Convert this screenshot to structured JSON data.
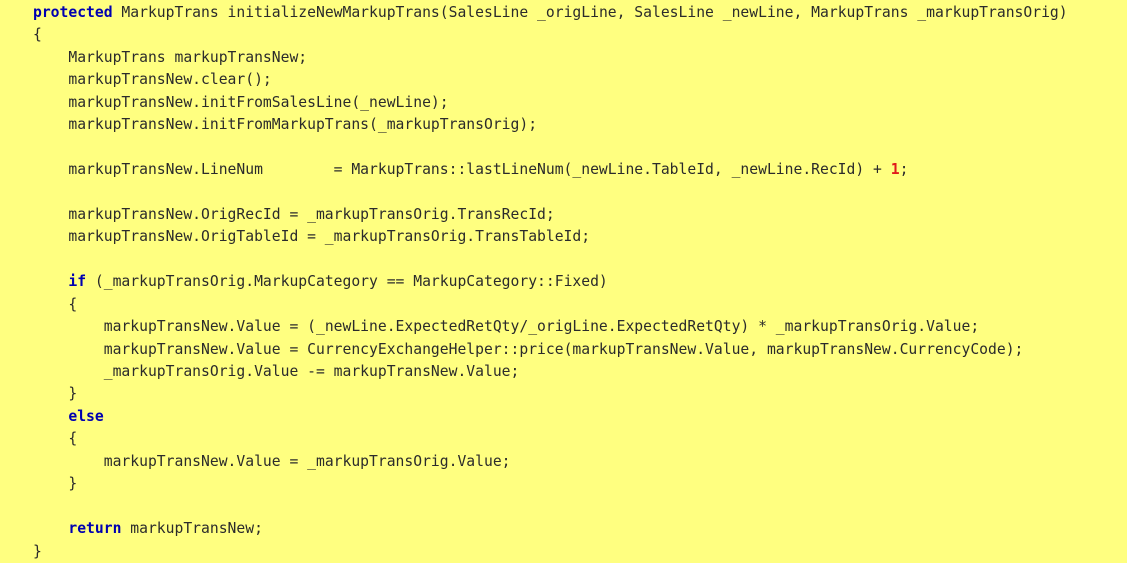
{
  "editor": {
    "name": "code-snippet-viewer",
    "language": "X++",
    "background_color": "#ffff80",
    "text_color": "#2b2b2b",
    "keyword_color": "#0000b0",
    "number_color": "#e01b1b",
    "indent_unit": "    ",
    "font_size_px": 14.7,
    "line_height_px": 22.45
  },
  "code": {
    "line_count": 24,
    "lines": [
      {
        "index": 1,
        "indent": 0,
        "tokens": [
          {
            "t": "kw",
            "v": "protected"
          },
          {
            "t": "pl",
            "v": " MarkupTrans initializeNewMarkupTrans(SalesLine _origLine, SalesLine _newLine, MarkupTrans _markupTransOrig)"
          }
        ]
      },
      {
        "index": 2,
        "indent": 0,
        "tokens": [
          {
            "t": "pl",
            "v": "{"
          }
        ]
      },
      {
        "index": 3,
        "indent": 1,
        "tokens": [
          {
            "t": "pl",
            "v": "MarkupTrans markupTransNew;"
          }
        ]
      },
      {
        "index": 4,
        "indent": 1,
        "tokens": [
          {
            "t": "pl",
            "v": "markupTransNew.clear();"
          }
        ]
      },
      {
        "index": 5,
        "indent": 1,
        "tokens": [
          {
            "t": "pl",
            "v": "markupTransNew.initFromSalesLine(_newLine);"
          }
        ]
      },
      {
        "index": 6,
        "indent": 1,
        "tokens": [
          {
            "t": "pl",
            "v": "markupTransNew.initFromMarkupTrans(_markupTransOrig);"
          }
        ]
      },
      {
        "index": 7,
        "indent": 0,
        "tokens": [
          {
            "t": "pl",
            "v": ""
          }
        ]
      },
      {
        "index": 8,
        "indent": 1,
        "tokens": [
          {
            "t": "pl",
            "v": "markupTransNew.LineNum        = MarkupTrans::lastLineNum(_newLine.TableId, _newLine.RecId) + "
          },
          {
            "t": "num",
            "v": "1"
          },
          {
            "t": "pl",
            "v": ";"
          }
        ]
      },
      {
        "index": 9,
        "indent": 0,
        "tokens": [
          {
            "t": "pl",
            "v": ""
          }
        ]
      },
      {
        "index": 10,
        "indent": 1,
        "tokens": [
          {
            "t": "pl",
            "v": "markupTransNew.OrigRecId = _markupTransOrig.TransRecId;"
          }
        ]
      },
      {
        "index": 11,
        "indent": 1,
        "tokens": [
          {
            "t": "pl",
            "v": "markupTransNew.OrigTableId = _markupTransOrig.TransTableId;"
          }
        ]
      },
      {
        "index": 12,
        "indent": 0,
        "tokens": [
          {
            "t": "pl",
            "v": ""
          }
        ]
      },
      {
        "index": 13,
        "indent": 1,
        "tokens": [
          {
            "t": "kw",
            "v": "if"
          },
          {
            "t": "pl",
            "v": " (_markupTransOrig.MarkupCategory == MarkupCategory::Fixed)"
          }
        ]
      },
      {
        "index": 14,
        "indent": 1,
        "tokens": [
          {
            "t": "pl",
            "v": "{"
          }
        ]
      },
      {
        "index": 15,
        "indent": 2,
        "tokens": [
          {
            "t": "pl",
            "v": "markupTransNew.Value = (_newLine.ExpectedRetQty/_origLine.ExpectedRetQty) * _markupTransOrig.Value;"
          }
        ]
      },
      {
        "index": 16,
        "indent": 2,
        "tokens": [
          {
            "t": "pl",
            "v": "markupTransNew.Value = CurrencyExchangeHelper::price(markupTransNew.Value, markupTransNew.CurrencyCode);"
          }
        ]
      },
      {
        "index": 17,
        "indent": 2,
        "tokens": [
          {
            "t": "pl",
            "v": "_markupTransOrig.Value -= markupTransNew.Value;"
          }
        ]
      },
      {
        "index": 18,
        "indent": 1,
        "tokens": [
          {
            "t": "pl",
            "v": "}"
          }
        ]
      },
      {
        "index": 19,
        "indent": 1,
        "tokens": [
          {
            "t": "kw",
            "v": "else"
          }
        ]
      },
      {
        "index": 20,
        "indent": 1,
        "tokens": [
          {
            "t": "pl",
            "v": "{"
          }
        ]
      },
      {
        "index": 21,
        "indent": 2,
        "tokens": [
          {
            "t": "pl",
            "v": "markupTransNew.Value = _markupTransOrig.Value;"
          }
        ]
      },
      {
        "index": 22,
        "indent": 1,
        "tokens": [
          {
            "t": "pl",
            "v": "}"
          }
        ]
      },
      {
        "index": 23,
        "indent": 0,
        "tokens": [
          {
            "t": "pl",
            "v": ""
          }
        ]
      },
      {
        "index": 24,
        "indent": 1,
        "tokens": [
          {
            "t": "kw",
            "v": "return"
          },
          {
            "t": "pl",
            "v": " markupTransNew;"
          }
        ]
      },
      {
        "index": 25,
        "indent": 0,
        "tokens": [
          {
            "t": "pl",
            "v": "}"
          }
        ]
      }
    ]
  }
}
